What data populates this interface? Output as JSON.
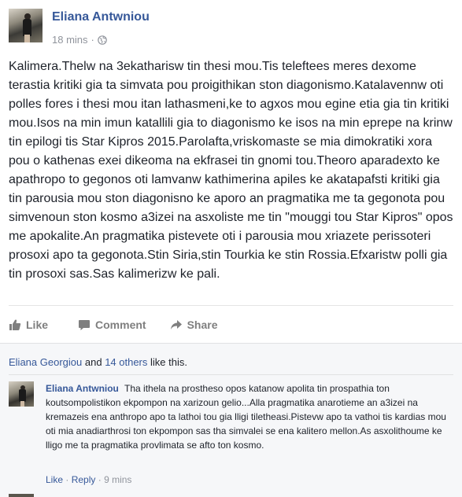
{
  "post": {
    "author": "Eliana Antwniou",
    "time": "18 mins",
    "separator": "·",
    "privacy_icon": "globe-icon",
    "text": "Kalimera.Thelw na 3ekatharisw tin thesi mou.Tis teleftees meres dexome terastia kritiki gia ta simvata pou proigithikan ston diagonismo.Katalavennw oti polles fores i thesi mou itan lathasmeni,ke to agxos mou egine etia gia tin kritiki mou.Isos na min imun katallili gia to diagonismo ke isos na min eprepe na krinw tin epilogi tis Star Kipros 2015.Parolafta,vriskomaste se mia dimokratiki xora pou o kathenas exei dikeoma na ekfrasei tin gnomi tou.Theoro aparadexto ke apathropo to gegonos oti lamvanw kathimerina apiles ke akatapafsti kritiki gia tin parousia mou ston diagonisno ke aporo an pragmatika me ta gegonota pou simvenoun ston kosmo a3izei na asxoliste me tin \"mouggi tou Star Kipros\" opos me apokalite.An pragmatika pistevete oti i parousia mou xriazete perissoteri prosoxi apo ta gegonota.Stin Siria,stin Tourkia ke stin Rossia.Efxaristw polli gia tin prosoxi sas.Sas kalimerizw ke pali."
  },
  "actions": {
    "like": "Like",
    "comment": "Comment",
    "share": "Share"
  },
  "likes": {
    "name": "Eliana Georgiou",
    "and": "and",
    "others": "14 others",
    "suffix": "like this."
  },
  "comment": {
    "author": "Eliana Antwniou",
    "text": "Tha ithela na prostheso opos katanow apolita tin prospathia ton koutsompolistikon ekpompon na xarizoun gelio...Alla pragmatika anarotieme an a3izei na kremazeis ena anthropo apo ta lathoi tou gia lligi tiletheasi.Pistevw apo ta vathoi tis kardias mou oti mia anadiarthrosi ton ekpompon sas tha simvalei se ena kalitero mellon.As asxolithoume ke lligo me ta pragmatika provlimata se afto ton kosmo.",
    "like": "Like",
    "reply": "Reply",
    "sep": "·",
    "time": "9 mins"
  },
  "colors": {
    "link": "#365899",
    "meta": "#90949c",
    "action": "#7f7f7f",
    "feedback_bg": "#f6f7f9"
  }
}
